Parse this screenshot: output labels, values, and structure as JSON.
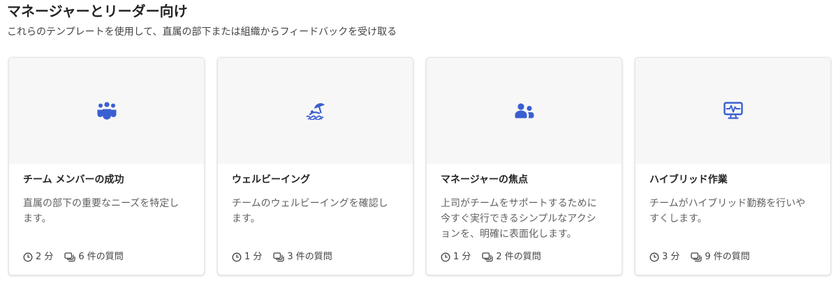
{
  "section": {
    "title": "マネージャーとリーダー向け",
    "subtitle": "これらのテンプレートを使用して、直属の部下または組織からフィードバックを受け取る"
  },
  "colors": {
    "accent": "#3a5fd1",
    "hero_background": "#f7f7f7"
  },
  "cards": [
    {
      "icon": "team-people-icon",
      "title": "チーム メンバーの成功",
      "description": "直属の部下の重要なニーズを特定します。",
      "duration": "2 分",
      "questions": "6 件の質問"
    },
    {
      "icon": "beach-umbrella-icon",
      "title": "ウェルビーイング",
      "description": "チームのウェルビーイングを確認します。",
      "duration": "1 分",
      "questions": "3 件の質問"
    },
    {
      "icon": "people-pair-icon",
      "title": "マネージャーの焦点",
      "description": "上司がチームをサポートするために今すぐ実行できるシンプルなアクションを、明確に表面化します。",
      "duration": "1 分",
      "questions": "2 件の質問"
    },
    {
      "icon": "monitor-pulse-icon",
      "title": "ハイブリッド作業",
      "description": "チームがハイブリッド勤務を行いやすくします。",
      "duration": "3 分",
      "questions": "9 件の質問"
    }
  ]
}
